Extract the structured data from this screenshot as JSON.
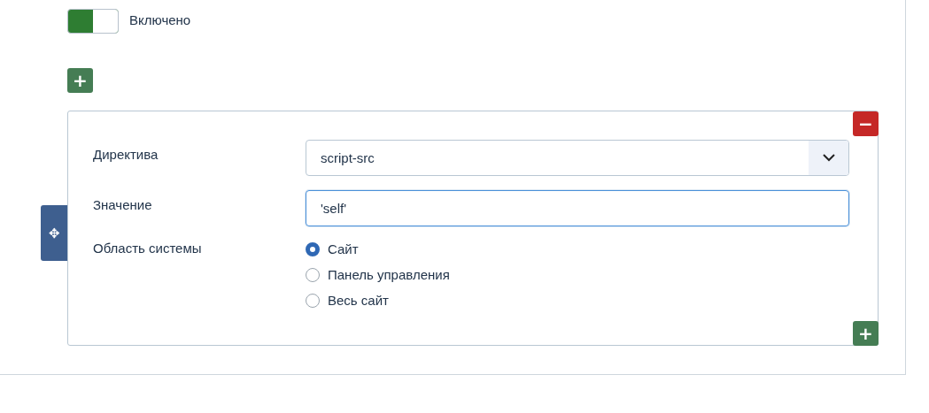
{
  "toggle": {
    "on": true,
    "label": "Включено"
  },
  "add_button": {
    "label": "+"
  },
  "rule": {
    "remove_label": "−",
    "move_label": "✥",
    "add_label": "+",
    "fields": [
      {
        "kind": "select",
        "label": "Директива",
        "value": "script-src"
      },
      {
        "kind": "input",
        "label": "Значение",
        "value": "'self'"
      },
      {
        "kind": "radio",
        "label": "Область системы",
        "options": [
          {
            "label": "Сайт",
            "selected": true
          },
          {
            "label": "Панель управления",
            "selected": false
          },
          {
            "label": "Весь сайт",
            "selected": false
          }
        ]
      }
    ]
  }
}
